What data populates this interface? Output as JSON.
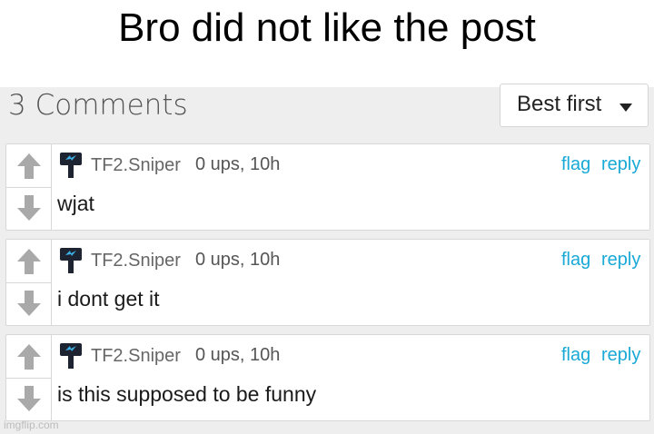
{
  "caption": "Bro did not like the post",
  "header": {
    "comments_count": "3 Comments",
    "sort_label": "Best first"
  },
  "colors": {
    "link": "#19a9d6",
    "panel_bg": "#eeeeee",
    "avatar_icon": "#1d2330",
    "avatar_bolt": "#3fb0e8",
    "vote_arrow": "#a9a9a9"
  },
  "comments": [
    {
      "username": "TF2.Sniper",
      "meta": "0 ups, 10h",
      "flag": "flag",
      "reply": "reply",
      "text": "wjat",
      "avatar_icon": "hammer-avatar-icon"
    },
    {
      "username": "TF2.Sniper",
      "meta": "0 ups, 10h",
      "flag": "flag",
      "reply": "reply",
      "text": "i dont get it",
      "avatar_icon": "hammer-avatar-icon"
    },
    {
      "username": "TF2.Sniper",
      "meta": "0 ups, 10h",
      "flag": "flag",
      "reply": "reply",
      "text": "is this supposed to be funny",
      "avatar_icon": "hammer-avatar-icon"
    }
  ],
  "watermark": "imgflip.com"
}
